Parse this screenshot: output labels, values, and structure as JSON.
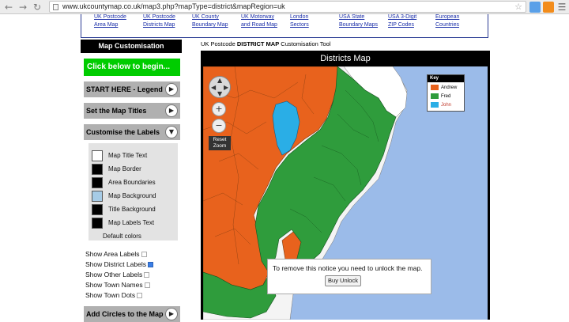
{
  "browser": {
    "url": "www.ukcountymap.co.uk/map3.php?mapType=district&mapRegion=uk"
  },
  "topnav": [
    {
      "line1": "UK Postcode",
      "line2": "Area Map"
    },
    {
      "line1": "UK Postcode",
      "line2": "Districts Map"
    },
    {
      "line1": "UK County",
      "line2": "Boundary Map"
    },
    {
      "line1": "UK Motorway",
      "line2": "and Road Map"
    },
    {
      "line1": "London",
      "line2": "Sectors"
    },
    {
      "line1": "USA State",
      "line2": "Boundary Maps"
    },
    {
      "line1": "USA 3-Digit",
      "line2": "ZIP Codes"
    },
    {
      "line1": "European",
      "line2": "Countries"
    }
  ],
  "tool_title": {
    "prefix": "UK Postcode ",
    "bold": "DISTRICT MAP",
    "suffix": " Customisation Tool"
  },
  "sidebar": {
    "header": "Map Customisation",
    "begin": "Click below to begin...",
    "buttons": [
      {
        "label": "START HERE - Legend",
        "icon": "play-icon"
      },
      {
        "label": "Set the Map Titles",
        "icon": "play-icon"
      },
      {
        "label": "Customise the Labels",
        "icon": "chevron-down-icon"
      }
    ],
    "label_colors": [
      {
        "label": "Map Title Text",
        "color": "#ffffff"
      },
      {
        "label": "Map Border",
        "color": "#000000"
      },
      {
        "label": "Area Boundaries",
        "color": "#000000"
      },
      {
        "label": "Map Background",
        "color": "#a6cbe6"
      },
      {
        "label": "Title Background",
        "color": "#000000"
      },
      {
        "label": "Map Labels Text",
        "color": "#000000"
      }
    ],
    "default_colors": "Default colors",
    "checkboxes": [
      {
        "label": "Show Area Labels",
        "checked": false
      },
      {
        "label": "Show District Labels",
        "checked": true
      },
      {
        "label": "Show Other Labels",
        "checked": false
      },
      {
        "label": "Show Town Names",
        "checked": false
      },
      {
        "label": "Show Town Dots",
        "checked": false
      }
    ],
    "bottom_button": "Add Circles to the Map"
  },
  "map": {
    "title": "Districts Map",
    "reset_zoom": "Reset Zoom",
    "legend": {
      "title": "Key",
      "items": [
        {
          "name": "Andrew",
          "color": "#e8621d"
        },
        {
          "name": "Fred",
          "color": "#2f9c3c"
        },
        {
          "name": "John",
          "color": "#2aaee6"
        }
      ]
    },
    "notice": "To remove this notice you need to unlock the map.",
    "unlock": "Buy Unlock"
  }
}
